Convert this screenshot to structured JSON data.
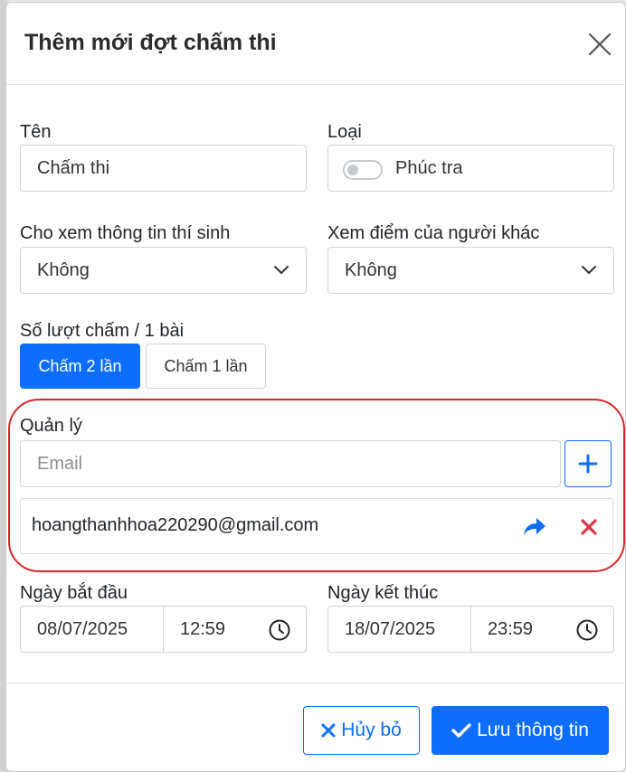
{
  "modal": {
    "title": "Thêm mới đợt chấm thi"
  },
  "form": {
    "name": {
      "label": "Tên",
      "value": "Chấm thi"
    },
    "type": {
      "label": "Loại",
      "toggle_label": "Phúc tra",
      "toggle_on": false
    },
    "show_candidate_info": {
      "label": "Cho xem thông tin thí sinh",
      "selected": "Không"
    },
    "view_others_scores": {
      "label": "Xem điểm của người khác",
      "selected": "Không"
    },
    "grading_rounds": {
      "label": "Số lượt chấm / 1 bài",
      "options": [
        "Chấm 2 lần",
        "Chấm 1 lần"
      ],
      "selected": "Chấm 2 lần"
    },
    "managers": {
      "label": "Quản lý",
      "email_placeholder": "Email",
      "list": [
        "hoangthanhhoa220290@gmail.com"
      ]
    },
    "start": {
      "label": "Ngày bắt đầu",
      "date": "08/07/2025",
      "time": "12:59"
    },
    "end": {
      "label": "Ngày kết thúc",
      "date": "18/07/2025",
      "time": "23:59"
    }
  },
  "footer": {
    "cancel_label": "Hủy bỏ",
    "save_label": "Lưu thông tin"
  },
  "colors": {
    "primary": "#0d6efd",
    "danger": "#dc3545",
    "highlight_outline": "#d9262a"
  }
}
